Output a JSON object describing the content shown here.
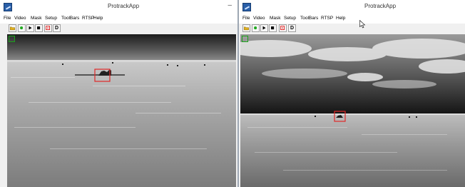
{
  "left_window": {
    "title": "ProtrackApp",
    "minimize": "–",
    "menu": [
      "File",
      "Video",
      "Mask",
      "Setup",
      "ToolBars",
      "RTSP",
      "Help"
    ],
    "toolbar": {
      "open": "open-folder-icon",
      "record": "record-icon",
      "play": "play-icon",
      "stop": "stop-icon",
      "target": "target-box-icon",
      "d_label": "D"
    }
  },
  "right_window": {
    "title": "ProtrackApp",
    "menu": [
      "File",
      "Video",
      "Mask",
      "Setup",
      "ToolBars",
      "RTSP",
      "Help"
    ],
    "toolbar": {
      "open": "open-folder-icon",
      "record": "record-icon",
      "play": "play-icon",
      "stop": "stop-icon",
      "target": "target-box-icon",
      "d_label": "D"
    }
  },
  "colors": {
    "tracking_box": "#e02828",
    "roi_marker": "#1aa31a",
    "record_green": "#22aa22",
    "folder_yellow": "#e0b020"
  }
}
